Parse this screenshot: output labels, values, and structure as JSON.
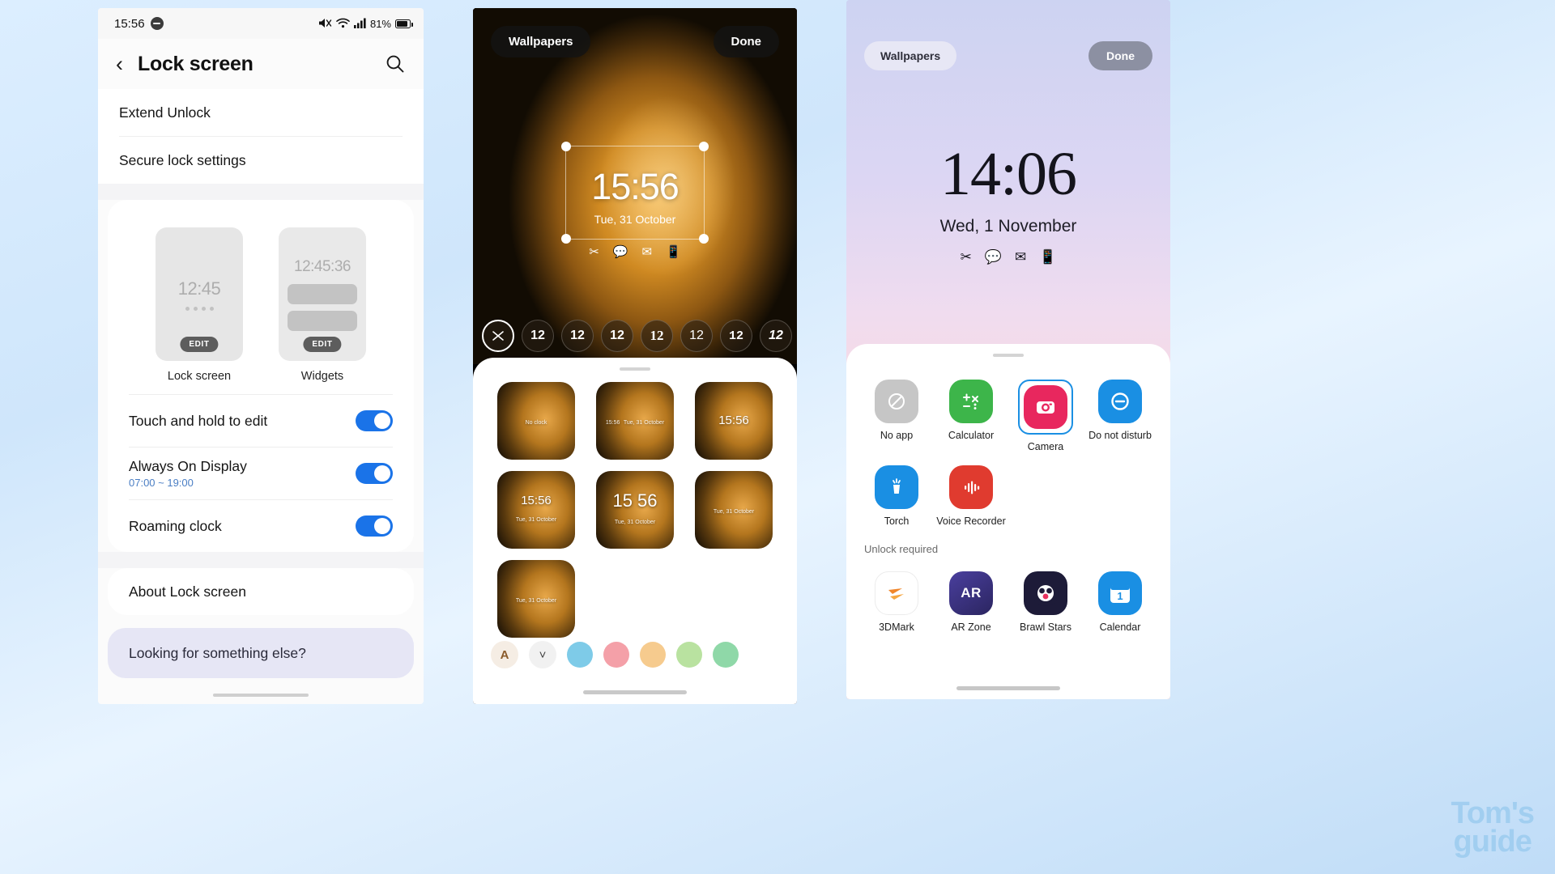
{
  "phone1": {
    "status": {
      "time": "15:56",
      "dnd_icon": "do-not-disturb-icon",
      "mute_icon": "mute-icon",
      "wifi_icon": "wifi-icon",
      "signal_icon": "signal-icon",
      "battery_text": "81%",
      "battery_icon": "battery-icon"
    },
    "appbar": {
      "back_icon": "back-arrow-icon",
      "title": "Lock screen",
      "search_icon": "search-icon"
    },
    "rows_top": [
      {
        "label": "Extend Unlock"
      },
      {
        "label": "Secure lock settings"
      }
    ],
    "previews": [
      {
        "time": "12:45",
        "label": "Lock screen",
        "edit": "EDIT",
        "type": "clock-dots"
      },
      {
        "time": "12:45:36",
        "label": "Widgets",
        "edit": "EDIT",
        "type": "clock-bars"
      }
    ],
    "toggles": [
      {
        "label": "Touch and hold to edit",
        "sub": "",
        "on": true
      },
      {
        "label": "Always On Display",
        "sub": "07:00 ~ 19:00",
        "on": true
      },
      {
        "label": "Roaming clock",
        "sub": "",
        "on": true
      }
    ],
    "rows_bottom": [
      {
        "label": "About Lock screen"
      }
    ],
    "footer": {
      "label": "Looking for something else?"
    }
  },
  "phone2": {
    "topbar": {
      "wallpapers_label": "Wallpapers",
      "done_label": "Done"
    },
    "clock": {
      "time": "15:56",
      "date": "Tue, 31 October"
    },
    "shortcuts": [
      "shortcut-icon-1",
      "chat-icon",
      "mail-icon",
      "phone-icon"
    ],
    "clock_styles": [
      {
        "label": "",
        "icon": "no-clock-icon",
        "selected": true
      },
      {
        "label": "12",
        "style": "serif"
      },
      {
        "label": "12",
        "style": "bold"
      },
      {
        "label": "12",
        "style": "outline"
      },
      {
        "label": "12",
        "style": "mono"
      },
      {
        "label": "12",
        "style": "thin"
      },
      {
        "label": "12",
        "style": "stencil"
      },
      {
        "label": "12",
        "style": "italic"
      }
    ],
    "wallpaper_thumbs": [
      {
        "caption": "No clock",
        "time": "",
        "date": ""
      },
      {
        "caption": "",
        "time": "15:56",
        "date": "Tue, 31 October"
      },
      {
        "caption": "",
        "time": "15:56",
        "date": ""
      },
      {
        "caption": "",
        "time": "15:56",
        "date": "Tue, 31 October"
      },
      {
        "caption": "",
        "time": "15 56",
        "date": "Tue, 31 October"
      },
      {
        "caption": "",
        "time": "",
        "date": "Tue, 31 October"
      },
      {
        "caption": "",
        "time": "",
        "date": "Tue, 31 October"
      }
    ],
    "palette": {
      "auto_label": "A",
      "check_icon": "chevron-down-icon",
      "colors": [
        "#7ecbe8",
        "#f4a0a8",
        "#f6cb8e",
        "#b9e2a0",
        "#8fd8a8"
      ]
    }
  },
  "phone3": {
    "topbar": {
      "wallpapers_label": "Wallpapers",
      "done_label": "Done"
    },
    "clock": {
      "time": "14:06",
      "date": "Wed, 1 November"
    },
    "shortcuts": [
      "shortcut-icon-1",
      "chat-icon",
      "mail-icon",
      "phone-icon"
    ],
    "apps": [
      {
        "name": "No app",
        "icon": "no-app-icon",
        "color": "#c6c6c6",
        "glyph": "⊘",
        "selected": false
      },
      {
        "name": "Calculator",
        "icon": "calculator-icon",
        "color": "#3db54a",
        "glyph": "÷",
        "selected": false
      },
      {
        "name": "Camera",
        "icon": "camera-icon",
        "color": "#e8275e",
        "glyph": "◉",
        "selected": true
      },
      {
        "name": "Do not disturb",
        "icon": "do-not-disturb-icon",
        "color": "#1a8fe3",
        "glyph": "⊖",
        "selected": false
      },
      {
        "name": "Torch",
        "icon": "torch-icon",
        "color": "#1a8fe3",
        "glyph": "✦",
        "selected": false
      },
      {
        "name": "Voice Recorder",
        "icon": "voice-recorder-icon",
        "color": "#e03b2f",
        "glyph": "‖",
        "selected": false
      }
    ],
    "unlock_section": {
      "label": "Unlock required"
    },
    "unlock_apps": [
      {
        "name": "3DMark",
        "icon": "3dmark-icon",
        "color": "#ffffff",
        "glyph": "➤"
      },
      {
        "name": "AR Zone",
        "icon": "ar-zone-icon",
        "color": "#3a3a78",
        "glyph": "AR"
      },
      {
        "name": "Brawl Stars",
        "icon": "brawl-stars-icon",
        "color": "#1a1a2e",
        "glyph": "★"
      },
      {
        "name": "Calendar",
        "icon": "calendar-icon",
        "color": "#1a8fe3",
        "glyph": "1"
      }
    ]
  },
  "watermark": {
    "line1": "Tom's",
    "line2": "guide"
  }
}
